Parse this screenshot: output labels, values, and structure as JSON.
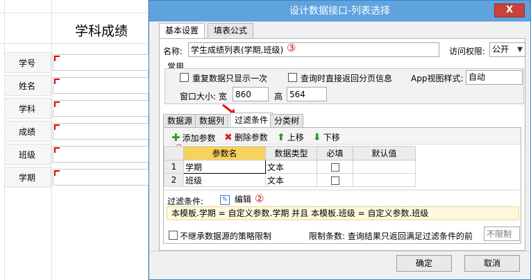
{
  "background_form": {
    "title": "学科成绩",
    "fields": [
      {
        "label": "学号"
      },
      {
        "label": "姓名"
      },
      {
        "label": "学科"
      },
      {
        "label": "成绩"
      },
      {
        "label": "班级"
      },
      {
        "label": "学期"
      }
    ]
  },
  "dialog": {
    "title": "设计数据接口-列表选择",
    "close_label": "X",
    "tabs": [
      {
        "label": "基本设置",
        "active": true
      },
      {
        "label": "填表公式",
        "active": false
      }
    ],
    "name_label": "名称:",
    "name_value": "学生成绩列表(学期,班级)",
    "access_label": "访问权限:",
    "access_value": "公开",
    "common": {
      "legend": "常用",
      "opt_no_repeat": "重复数据只显示一次",
      "opt_paging": "查询时直接返回分页信息",
      "app_view_label": "App视图样式:",
      "app_view_value": "自动",
      "window_size_label": "窗口大小: 宽",
      "width_value": "860",
      "height_label": "高",
      "height_value": "564"
    },
    "sub_tabs": [
      {
        "label": "数据源",
        "active": false
      },
      {
        "label": "数据列",
        "active": false
      },
      {
        "label": "过滤条件",
        "active": true
      },
      {
        "label": "分类树",
        "active": false
      }
    ],
    "toolbar": {
      "add": "添加参数",
      "delete": "删除参数",
      "up": "上移",
      "down": "下移"
    },
    "params_table": {
      "headers": [
        "参数名",
        "数据类型",
        "必填",
        "默认值"
      ],
      "rows": [
        {
          "num": "1",
          "name": "学期",
          "type": "文本",
          "required": false,
          "default": ""
        },
        {
          "num": "2",
          "name": "班级",
          "type": "文本",
          "required": false,
          "default": ""
        }
      ]
    },
    "filter": {
      "label": "过滤条件:",
      "edit_label": "编辑",
      "expression": "本模板.学期 = 自定义参数.学期 并且 本模板.班级 = 自定义参数.班级"
    },
    "no_inherit_label": "不继承数据源的策略限制",
    "limit_label": "限制条数: 查询结果只返回满足过滤条件的前",
    "limit_placeholder": "不限制",
    "ok_label": "确定",
    "cancel_label": "取消",
    "annotations": {
      "one": "①",
      "two": "②",
      "three": "③"
    }
  },
  "colors": {
    "titlebar": "#5ea2de",
    "close": "#c9433a",
    "header_selected": "#f6d35e",
    "annotation": "#d01010",
    "add_icon": "#2a9a2a",
    "delete_icon": "#d42020"
  },
  "icons": [
    "plus-icon",
    "delete-x-icon",
    "arrow-up-icon",
    "arrow-down-icon",
    "edit-icon",
    "chevron-down-icon",
    "pointer-arrow-icon"
  ]
}
